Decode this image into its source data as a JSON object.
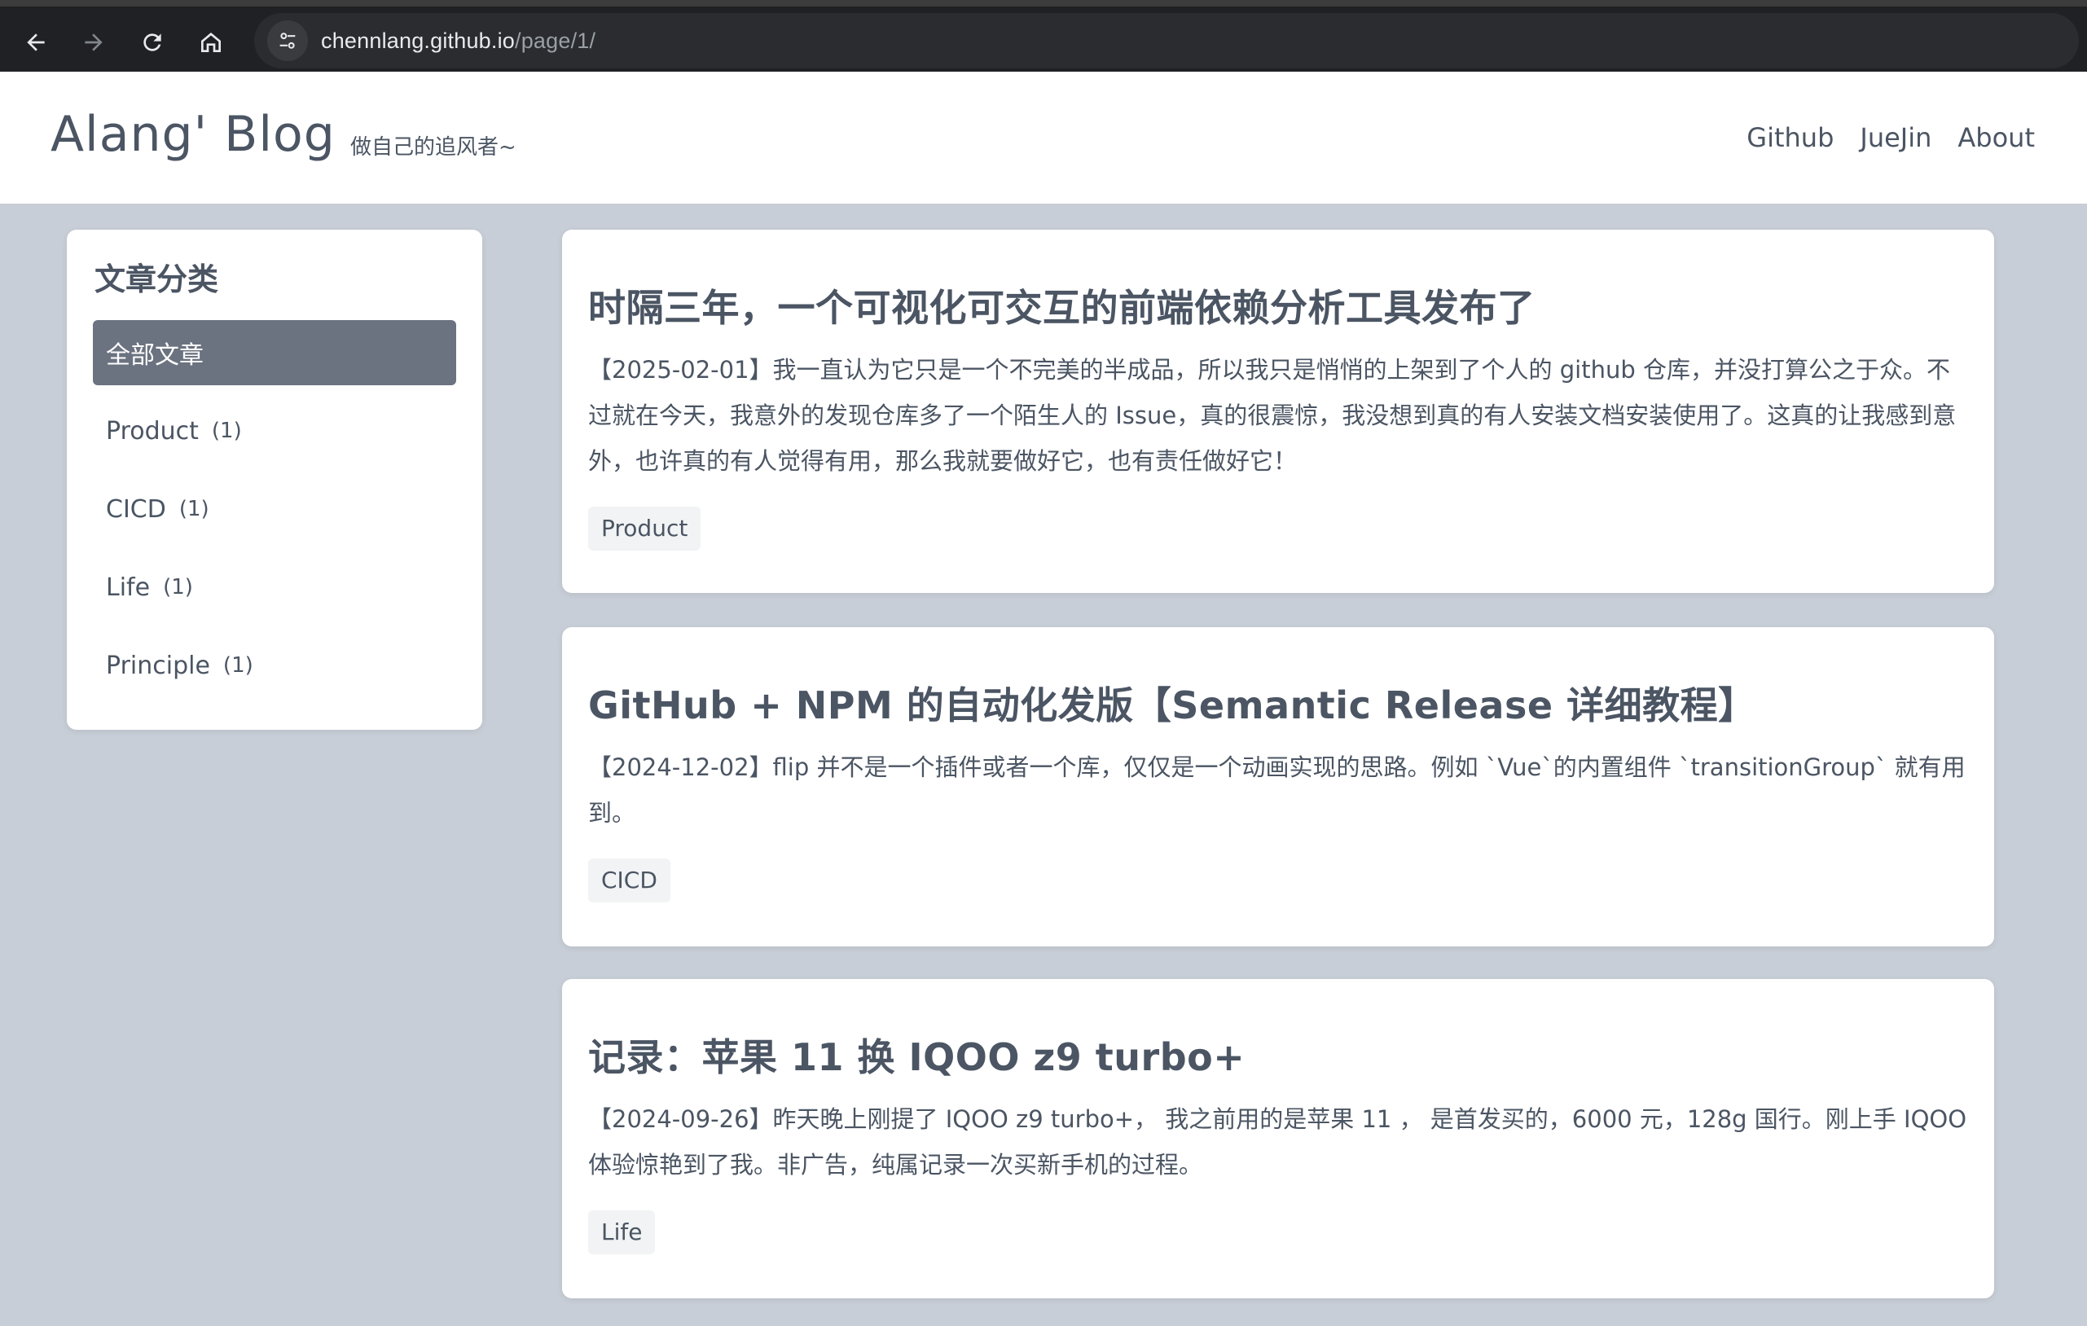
{
  "browser": {
    "url_host": "chennlang.github.io",
    "url_path": "/page/1/"
  },
  "header": {
    "brand": "Alang' Blog",
    "tagline": "做自己的追风者~",
    "nav": [
      "Github",
      "JueJin",
      "About"
    ]
  },
  "sidebar": {
    "title": "文章分类",
    "items": [
      {
        "label": "全部文章",
        "count": "",
        "active": true
      },
      {
        "label": "Product",
        "count": "(1)",
        "active": false
      },
      {
        "label": "CICD",
        "count": "(1)",
        "active": false
      },
      {
        "label": "Life",
        "count": "(1)",
        "active": false
      },
      {
        "label": "Principle",
        "count": "(1)",
        "active": false
      }
    ]
  },
  "posts": [
    {
      "title": "时隔三年，一个可视化可交互的前端依赖分析工具发布了",
      "summary": "【2025-02-01】我一直认为它只是一个不完美的半成品，所以我只是悄悄的上架到了个人的 github 仓库，并没打算公之于众。不过就在今天，我意外的发现仓库多了一个陌生人的 Issue，真的很震惊，我没想到真的有人安装文档安装使用了。这真的让我感到意外，也许真的有人觉得有用，那么我就要做好它，也有责任做好它！",
      "tag": "Product"
    },
    {
      "title": "GitHub + NPM 的自动化发版【Semantic Release 详细教程】",
      "summary": "【2024-12-02】flip 并不是一个插件或者一个库，仅仅是一个动画实现的思路。例如 `Vue`的内置组件 `transitionGroup` 就有用到。",
      "tag": "CICD"
    },
    {
      "title": "记录：苹果 11 换 IQOO z9 turbo+",
      "summary": "【2024-09-26】昨天晚上刚提了 IQOO z9 turbo+， 我之前用的是苹果 11 ， 是首发买的，6000 元，128g 国行。刚上手 IQOO 体验惊艳到了我。非广告，纯属记录一次买新手机的过程。",
      "tag": "Life"
    }
  ]
}
